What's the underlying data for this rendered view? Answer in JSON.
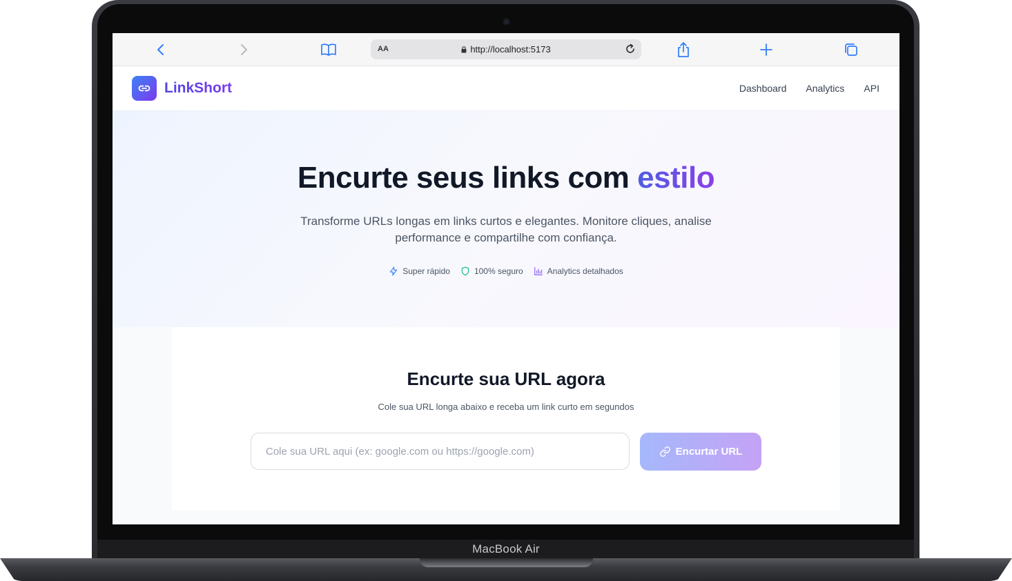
{
  "device": {
    "label": "MacBook Air"
  },
  "browser": {
    "address_prefix": "AA",
    "url": "http://localhost:5173",
    "icons": [
      "chevron-left-icon",
      "chevron-right-icon",
      "book-icon",
      "lock-icon",
      "reload-icon",
      "share-icon",
      "plus-icon",
      "tabs-icon"
    ]
  },
  "nav": {
    "brand": "LinkShort",
    "links": [
      "Dashboard",
      "Analytics",
      "API"
    ]
  },
  "hero": {
    "title_prefix": "Encurte seus links com ",
    "title_accent": "estilo",
    "subtitle": "Transforme URLs longas em links curtos e elegantes. Monitore cliques, analise performance e compartilhe com confiança.",
    "features": [
      {
        "label": "Super rápido",
        "icon": "zap-icon",
        "color": "#3b82f6"
      },
      {
        "label": "100% seguro",
        "icon": "shield-icon",
        "color": "#10b981"
      },
      {
        "label": "Analytics detalhados",
        "icon": "bar-chart-icon",
        "color": "#8b5cf6"
      }
    ]
  },
  "shortener": {
    "title": "Encurte sua URL agora",
    "description": "Cole sua URL longa abaixo e receba um link curto em segundos",
    "input_value": "",
    "input_placeholder": "Cole sua URL aqui (ex: google.com ou https://google.com)",
    "button_label": "Encurtar URL"
  },
  "colors": {
    "brand_gradient_start": "#3b82f6",
    "brand_gradient_end": "#7c3aed",
    "button_gradient_start": "#a5b8fb",
    "button_gradient_end": "#c5a2f5"
  }
}
